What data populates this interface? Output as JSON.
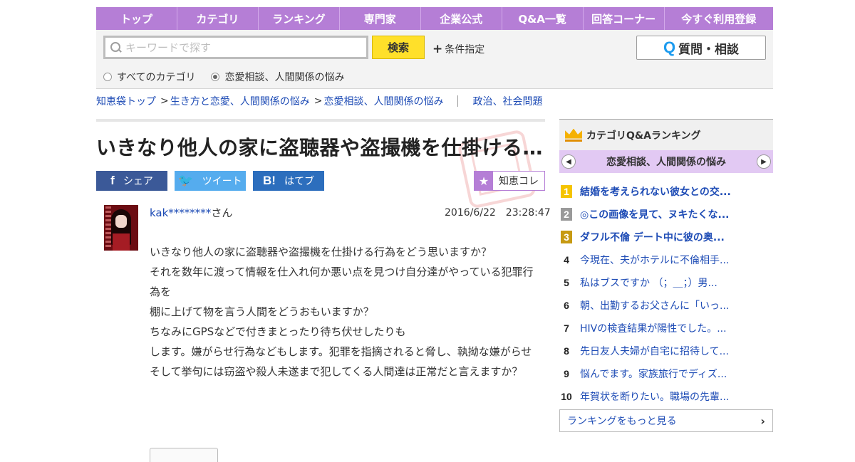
{
  "nav": {
    "items": [
      "トップ",
      "カテゴリ",
      "ランキング",
      "専門家",
      "企業公式",
      "Q&A一覧",
      "回答コーナー",
      "今すぐ利用登録"
    ]
  },
  "search": {
    "placeholder": "キーワードで探す",
    "button_label": "検索",
    "condition_label": "条件指定",
    "ask_button_label": "質問・相談",
    "radio_all": "すべてのカテゴリ",
    "radio_current": "恋愛相談、人間関係の悩み"
  },
  "breadcrumb": {
    "items": [
      "知恵袋トップ",
      "生き方と恋愛、人間関係の悩み",
      "恋愛相談、人間関係の悩み"
    ],
    "related": "政治、社会問題"
  },
  "question": {
    "title": "いきなり他人の家に盗聴器や盗撮機を仕掛ける…",
    "share_fb": "シェア",
    "share_tw": "ツイート",
    "share_hb": "はてブ",
    "chie_label": "知恵コレ",
    "user": "kak********",
    "user_suffix": "さん",
    "datetime": "2016/6/22　23:28:47",
    "body": [
      "いきなり他人の家に盗聴器や盗撮機を仕掛ける行為をどう思いますか？",
      "それを数年に渡って情報を仕入れ何か悪い点を見つけ自分達がやっている犯罪行為を",
      "棚に上げて物を言う人間をどうおもいますか？",
      "ちなみにGPSなどで付きまとったり待ち伏せしたりも",
      "します。嫌がらせ行為などもします。犯罪を指摘されると脅し、執拗な嫌がらせ",
      "そして挙句には窃盗や殺人未遂まで犯してくる人間達は正常だと言えますか？"
    ]
  },
  "ranking": {
    "title": "カテゴリQ&Aランキング",
    "category": "恋愛相談、人間関係の悩み",
    "items": [
      {
        "rank": "1",
        "text": "結婚を考えられない彼女との交..."
      },
      {
        "rank": "2",
        "text": "◎この画像を見て、ヌキたくな..."
      },
      {
        "rank": "3",
        "text": "ダフル不倫 デート中に彼の奥..."
      },
      {
        "rank": "4",
        "text": "今現在、夫がホテルに不倫相手..."
      },
      {
        "rank": "5",
        "text": "私はブスですか （；＿；）男..."
      },
      {
        "rank": "6",
        "text": "朝、出勤するお父さんに「いっ..."
      },
      {
        "rank": "7",
        "text": "HIVの検査結果が陽性でした。..."
      },
      {
        "rank": "8",
        "text": "先日友人夫婦が自宅に招待して..."
      },
      {
        "rank": "9",
        "text": "悩んでます。家族旅行でディズ..."
      },
      {
        "rank": "10",
        "text": "年賀状を断りたい。職場の先輩..."
      }
    ],
    "more_label": "ランキングをもっと見る"
  }
}
